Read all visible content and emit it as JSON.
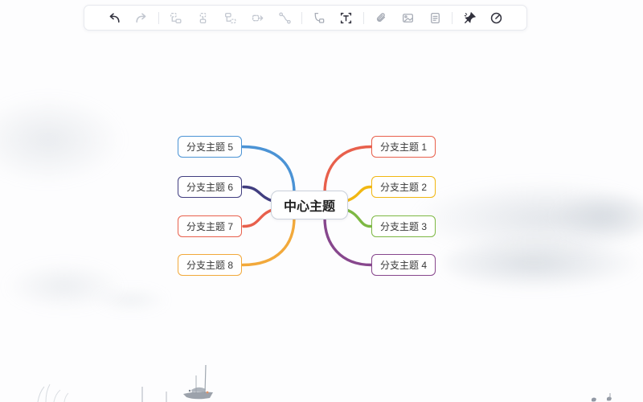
{
  "app": {
    "canvas_bg": "#FDFDFE"
  },
  "toolbar": {
    "colors": {
      "active": "#32323E",
      "muted": "#A7ACB6",
      "disabled": "#C2C7D0"
    },
    "items": [
      {
        "name": "undo",
        "state": "enabled"
      },
      {
        "name": "redo",
        "state": "disabled"
      },
      {
        "name": "insert-sibling-node",
        "state": "disabled"
      },
      {
        "name": "insert-child-node",
        "state": "disabled"
      },
      {
        "name": "insert-node-above",
        "state": "disabled"
      },
      {
        "name": "insert-parent-node",
        "state": "disabled"
      },
      {
        "name": "relation-line",
        "state": "disabled"
      },
      {
        "name": "summary",
        "state": "muted"
      },
      {
        "name": "text",
        "state": "enabled"
      },
      {
        "name": "hyperlink",
        "state": "muted"
      },
      {
        "name": "image",
        "state": "muted"
      },
      {
        "name": "note",
        "state": "muted"
      },
      {
        "name": "sticker",
        "state": "enabled"
      },
      {
        "name": "gauge",
        "state": "enabled"
      }
    ]
  },
  "mindmap": {
    "center": {
      "label": "中心主题",
      "border_color": "#CBD1DB"
    },
    "branches": [
      {
        "label": "分支主题 1",
        "color": "#E8604C",
        "side": "right"
      },
      {
        "label": "分支主题 2",
        "color": "#F1B712",
        "side": "right"
      },
      {
        "label": "分支主题 3",
        "color": "#7DB843",
        "side": "right"
      },
      {
        "label": "分支主题 4",
        "color": "#87478D",
        "side": "right"
      },
      {
        "label": "分支主题 5",
        "color": "#4B93D5",
        "side": "left"
      },
      {
        "label": "分支主题 6",
        "color": "#413E80",
        "side": "left"
      },
      {
        "label": "分支主题 7",
        "color": "#E8604C",
        "side": "left"
      },
      {
        "label": "分支主题 8",
        "color": "#F2A93B",
        "side": "left"
      }
    ]
  }
}
